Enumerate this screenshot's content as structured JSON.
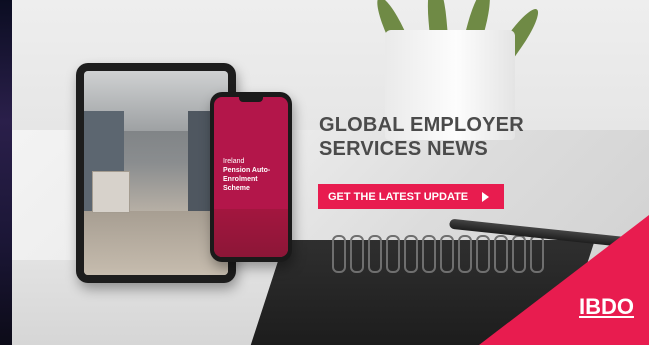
{
  "headline": {
    "line1": "GLOBAL EMPLOYER",
    "line2": "SERVICES NEWS"
  },
  "cta": {
    "label": "GET THE LATEST UPDATE",
    "icon": "play-arrow-icon"
  },
  "phone": {
    "country": "Ireland",
    "scheme_line1": "Pension Auto-",
    "scheme_line2": "Enrolment",
    "scheme_line3": "Scheme"
  },
  "logo": {
    "text": "IBDO"
  },
  "colors": {
    "accent": "#e81c4f",
    "phone_screen": "#b3164a",
    "headline_text": "#4b4b4b"
  }
}
